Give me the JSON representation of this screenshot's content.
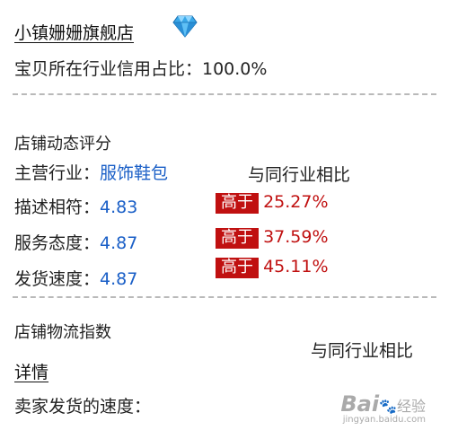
{
  "shop": {
    "name": "小镇姗姗旗舰店",
    "credit_text": "宝贝所在行业信用占比：100.0%"
  },
  "rating": {
    "title": "店铺动态评分",
    "industry_label": "主营行业：",
    "industry_value": "服饰鞋包",
    "compare_header": "与同行业相比",
    "rows": [
      {
        "label": "描述相符：",
        "score": "4.83",
        "badge": "高于",
        "percent": "25.27%"
      },
      {
        "label": "服务态度：",
        "score": "4.87",
        "badge": "高于",
        "percent": "37.59%"
      },
      {
        "label": "发货速度：",
        "score": "4.87",
        "badge": "高于",
        "percent": "45.11%"
      }
    ]
  },
  "logistics": {
    "title": "店铺物流指数",
    "compare_header": "与同行业相比",
    "detail_link": "详情",
    "speed_label": "卖家发货的速度："
  },
  "watermark": {
    "brand": "Bai",
    "suffix": "经验",
    "url": "jingyan.baidu.com"
  },
  "colors": {
    "link_blue": "#1a5fc7",
    "badge_red": "#c01010",
    "divider": "#b9b9b9"
  },
  "icons": {
    "shop_level": "diamond-icon"
  }
}
